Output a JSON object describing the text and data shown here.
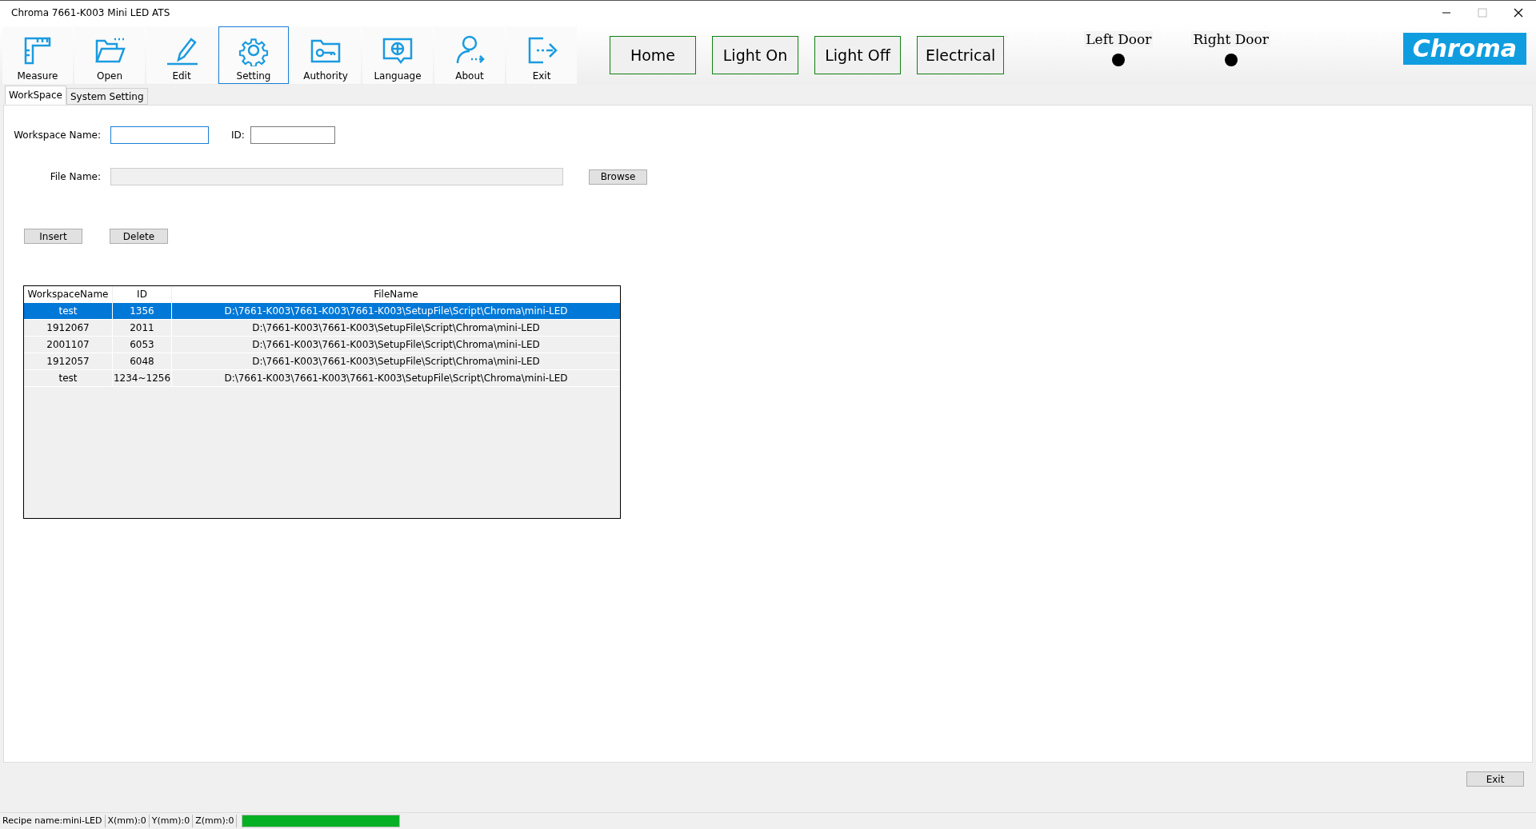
{
  "window": {
    "title": "Chroma 7661-K003 Mini LED ATS"
  },
  "toolbar": [
    {
      "label": "Measure",
      "kind": "ruler",
      "selected": false
    },
    {
      "label": "Open",
      "kind": "folder",
      "selected": false
    },
    {
      "label": "Edit",
      "kind": "pen",
      "selected": false
    },
    {
      "label": "Setting",
      "kind": "gear",
      "selected": true
    },
    {
      "label": "Authority",
      "kind": "key",
      "selected": false
    },
    {
      "label": "Language",
      "kind": "globe",
      "selected": false
    },
    {
      "label": "About",
      "kind": "user",
      "selected": false
    },
    {
      "label": "Exit",
      "kind": "exit",
      "selected": false
    }
  ],
  "action_buttons": [
    "Home",
    "Light On",
    "Light Off",
    "Electrical"
  ],
  "doors": [
    {
      "label": "Left Door"
    },
    {
      "label": "Right Door"
    }
  ],
  "logo": "Chroma",
  "tabs": [
    {
      "label": "WorkSpace",
      "selected": true
    },
    {
      "label": "System  Setting",
      "selected": false
    }
  ],
  "form": {
    "workspace_name_label": "Workspace Name:",
    "id_label": "ID:",
    "file_name_label": "File Name:",
    "browse": "Browse",
    "insert": "Insert",
    "delete": "Delete"
  },
  "table": {
    "columns": [
      "WorkspaceName",
      "ID",
      "FileName"
    ],
    "rows": [
      {
        "cells": [
          "test",
          "1356",
          "D:\\7661-K003\\7661-K003\\7661-K003\\SetupFile\\Script\\Chroma\\mini-LED"
        ],
        "selected": true
      },
      {
        "cells": [
          "1912067",
          "2011",
          "D:\\7661-K003\\7661-K003\\SetupFile\\Script\\Chroma\\mini-LED"
        ],
        "selected": false
      },
      {
        "cells": [
          "2001107",
          "6053",
          "D:\\7661-K003\\7661-K003\\SetupFile\\Script\\Chroma\\mini-LED"
        ],
        "selected": false
      },
      {
        "cells": [
          "1912057",
          "6048",
          "D:\\7661-K003\\7661-K003\\SetupFile\\Script\\Chroma\\mini-LED"
        ],
        "selected": false
      },
      {
        "cells": [
          "test",
          "1234~1256",
          "D:\\7661-K003\\7661-K003\\7661-K003\\SetupFile\\Script\\Chroma\\mini-LED"
        ],
        "selected": false
      }
    ]
  },
  "exit_button": "Exit",
  "status_bar": {
    "items": [
      "Recipe name:mini-LED",
      "X(mm):0",
      "Y(mm):0",
      "Z(mm):0"
    ],
    "progress": {
      "level": 1
    }
  }
}
